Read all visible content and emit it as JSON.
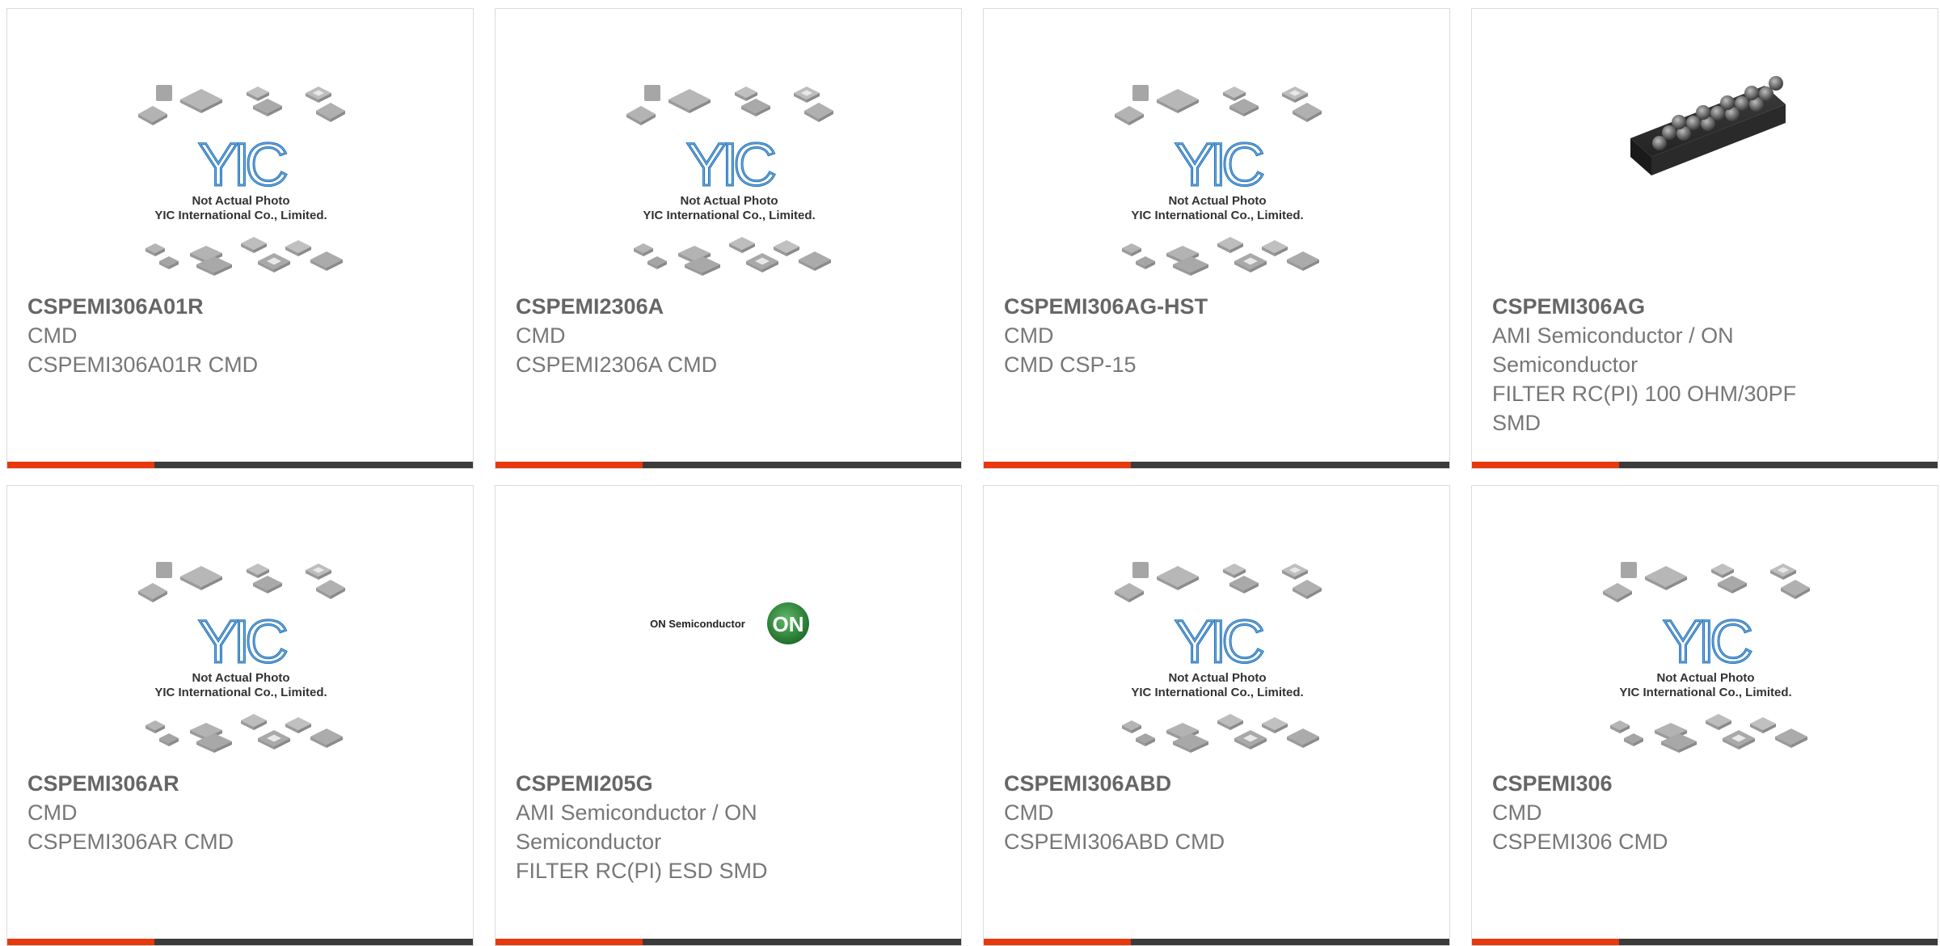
{
  "products": [
    {
      "part": "CSPEMI306A01R",
      "manufacturer": "CMD",
      "description": "CSPEMI306A01R CMD",
      "image": "yic-placeholder"
    },
    {
      "part": "CSPEMI2306A",
      "manufacturer": "CMD",
      "description": "CSPEMI2306A CMD",
      "image": "yic-placeholder"
    },
    {
      "part": "CSPEMI306AG-HST",
      "manufacturer": "CMD",
      "description": "CMD CSP-15",
      "image": "yic-placeholder"
    },
    {
      "part": "CSPEMI306AG",
      "manufacturer": "AMI Semiconductor / ON Semiconductor",
      "description": "FILTER RC(PI) 100 OHM/30PF SMD",
      "image": "bga-chip-photo"
    },
    {
      "part": "CSPEMI306AR",
      "manufacturer": "CMD",
      "description": "CSPEMI306AR CMD",
      "image": "yic-placeholder"
    },
    {
      "part": "CSPEMI205G",
      "manufacturer": "AMI Semiconductor / ON Semiconductor",
      "description": "FILTER RC(PI) ESD SMD",
      "image": "on-semiconductor-logo"
    },
    {
      "part": "CSPEMI306ABD",
      "manufacturer": "CMD",
      "description": "CSPEMI306ABD CMD",
      "image": "yic-placeholder"
    },
    {
      "part": "CSPEMI306",
      "manufacturer": "CMD",
      "description": "CSPEMI306 CMD",
      "image": "yic-placeholder"
    }
  ],
  "placeholder": {
    "brand": "YIC",
    "line1": "Not Actual Photo",
    "line2": "YIC International Co., Limited."
  },
  "on_logo": {
    "wordmark": "ON Semiconductor",
    "badge": "ON"
  },
  "colors": {
    "accent": "#e8380d",
    "bar": "#3b3b3b",
    "yic_blue": "#1d6fb8",
    "on_green": "#2e8b3a"
  }
}
